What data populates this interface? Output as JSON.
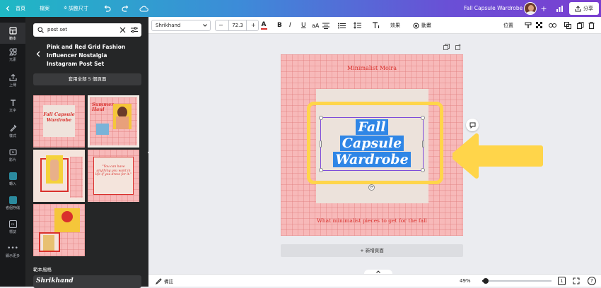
{
  "topbar": {
    "home": "首頁",
    "file": "檔案",
    "resize": "調整尺寸",
    "doc_title": "Fall Capsule Wardrobe",
    "share": "分享"
  },
  "rail": [
    {
      "label": "範本",
      "icon": "template-icon"
    },
    {
      "label": "元素",
      "icon": "elements-icon"
    },
    {
      "label": "上傳",
      "icon": "upload-icon"
    },
    {
      "label": "文字",
      "icon": "text-icon"
    },
    {
      "label": "樣式",
      "icon": "styles-icon"
    },
    {
      "label": "影片",
      "icon": "video-icon"
    },
    {
      "label": "轉入",
      "icon": "import-icon"
    },
    {
      "label": "者個存儲",
      "icon": "storage-icon"
    },
    {
      "label": "標誌",
      "icon": "logo-icon"
    },
    {
      "label": "顯示更多",
      "icon": "more-icon"
    }
  ],
  "panel": {
    "search_value": "post set",
    "template_title": "Pink and Red Grid Fashion Influencer Nostalgia Instagram Post Set",
    "apply_all": "套用全部 5 個頁面",
    "section_label": "範本風格",
    "font_preview": "Shrikhand",
    "thumbs": [
      {
        "title": "Fall Capsule Wardrobe"
      },
      {
        "title": "Summer Haul"
      },
      {
        "title": ""
      },
      {
        "title": "\"You can have anything you want in life if you dress for it.\""
      },
      {
        "title": ""
      }
    ]
  },
  "toolbar": {
    "font_name": "Shrikhand",
    "font_size": "72.3",
    "minus": "−",
    "plus": "+",
    "effects": "效果",
    "animate": "動畫",
    "position": "位置"
  },
  "design": {
    "brand": "Minimalist Moira",
    "headline_1": "Fall",
    "headline_2": "Capsule",
    "headline_3": "Wardrobe",
    "subtitle": "What minimalist pieces to get for the fall",
    "add_page": "+ 新增頁面"
  },
  "bottom": {
    "notes": "備註",
    "zoom": "49%",
    "page_num": "1"
  },
  "colors": {
    "brand_red": "#d9302c",
    "selection": "#2f86e6",
    "highlight": "#ffd54a",
    "page_pink": "#f7b9b9"
  }
}
